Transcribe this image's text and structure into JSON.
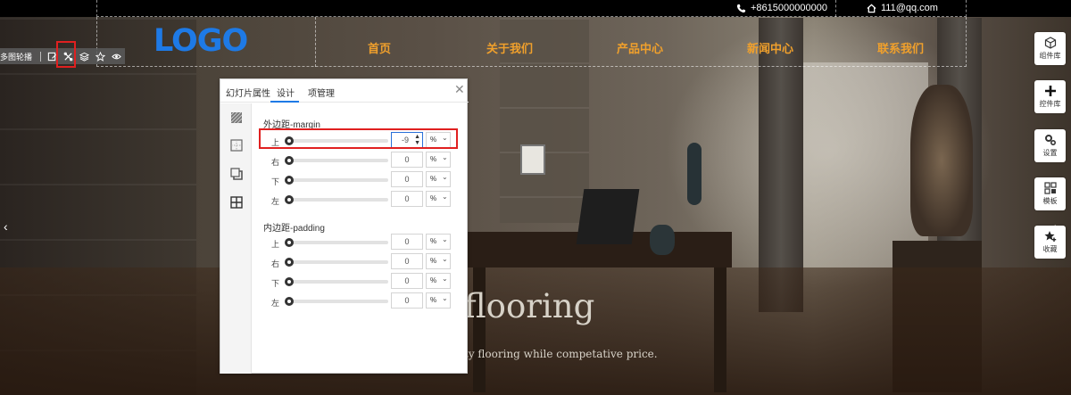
{
  "header": {
    "phone": "+8615000000000",
    "email": "111@qq.com",
    "logo": "LOGO",
    "nav": [
      "首页",
      "关于我们",
      "产品中心",
      "新闻中心",
      "联系我们"
    ]
  },
  "toolbar": {
    "title": "多图轮播"
  },
  "dock": [
    {
      "label": "组件库",
      "icon": "cube-icon"
    },
    {
      "label": "控件库",
      "icon": "plus-icon"
    },
    {
      "label": "设置",
      "icon": "gears-icon"
    },
    {
      "label": "模板",
      "icon": "grid-icon"
    },
    {
      "label": "收藏",
      "icon": "star-icon"
    }
  ],
  "banner": {
    "title": "flooring",
    "subtitle": "ty flooring while competative price."
  },
  "dialog": {
    "tabs": [
      "幻灯片属性",
      "设计",
      "项管理"
    ],
    "active_tab": "设计",
    "margin": {
      "title": "外边距-margin",
      "rows": [
        {
          "label": "上",
          "value": "-9",
          "unit": "%"
        },
        {
          "label": "右",
          "value": "0",
          "unit": "%"
        },
        {
          "label": "下",
          "value": "0",
          "unit": "%"
        },
        {
          "label": "左",
          "value": "0",
          "unit": "%"
        }
      ]
    },
    "padding": {
      "title": "内边距-padding",
      "rows": [
        {
          "label": "上",
          "value": "0",
          "unit": "%"
        },
        {
          "label": "右",
          "value": "0",
          "unit": "%"
        },
        {
          "label": "下",
          "value": "0",
          "unit": "%"
        },
        {
          "label": "左",
          "value": "0",
          "unit": "%"
        }
      ]
    }
  },
  "colors": {
    "accent": "#1e7ae6",
    "nav": "#f0a02c",
    "highlight": "#e02020"
  }
}
